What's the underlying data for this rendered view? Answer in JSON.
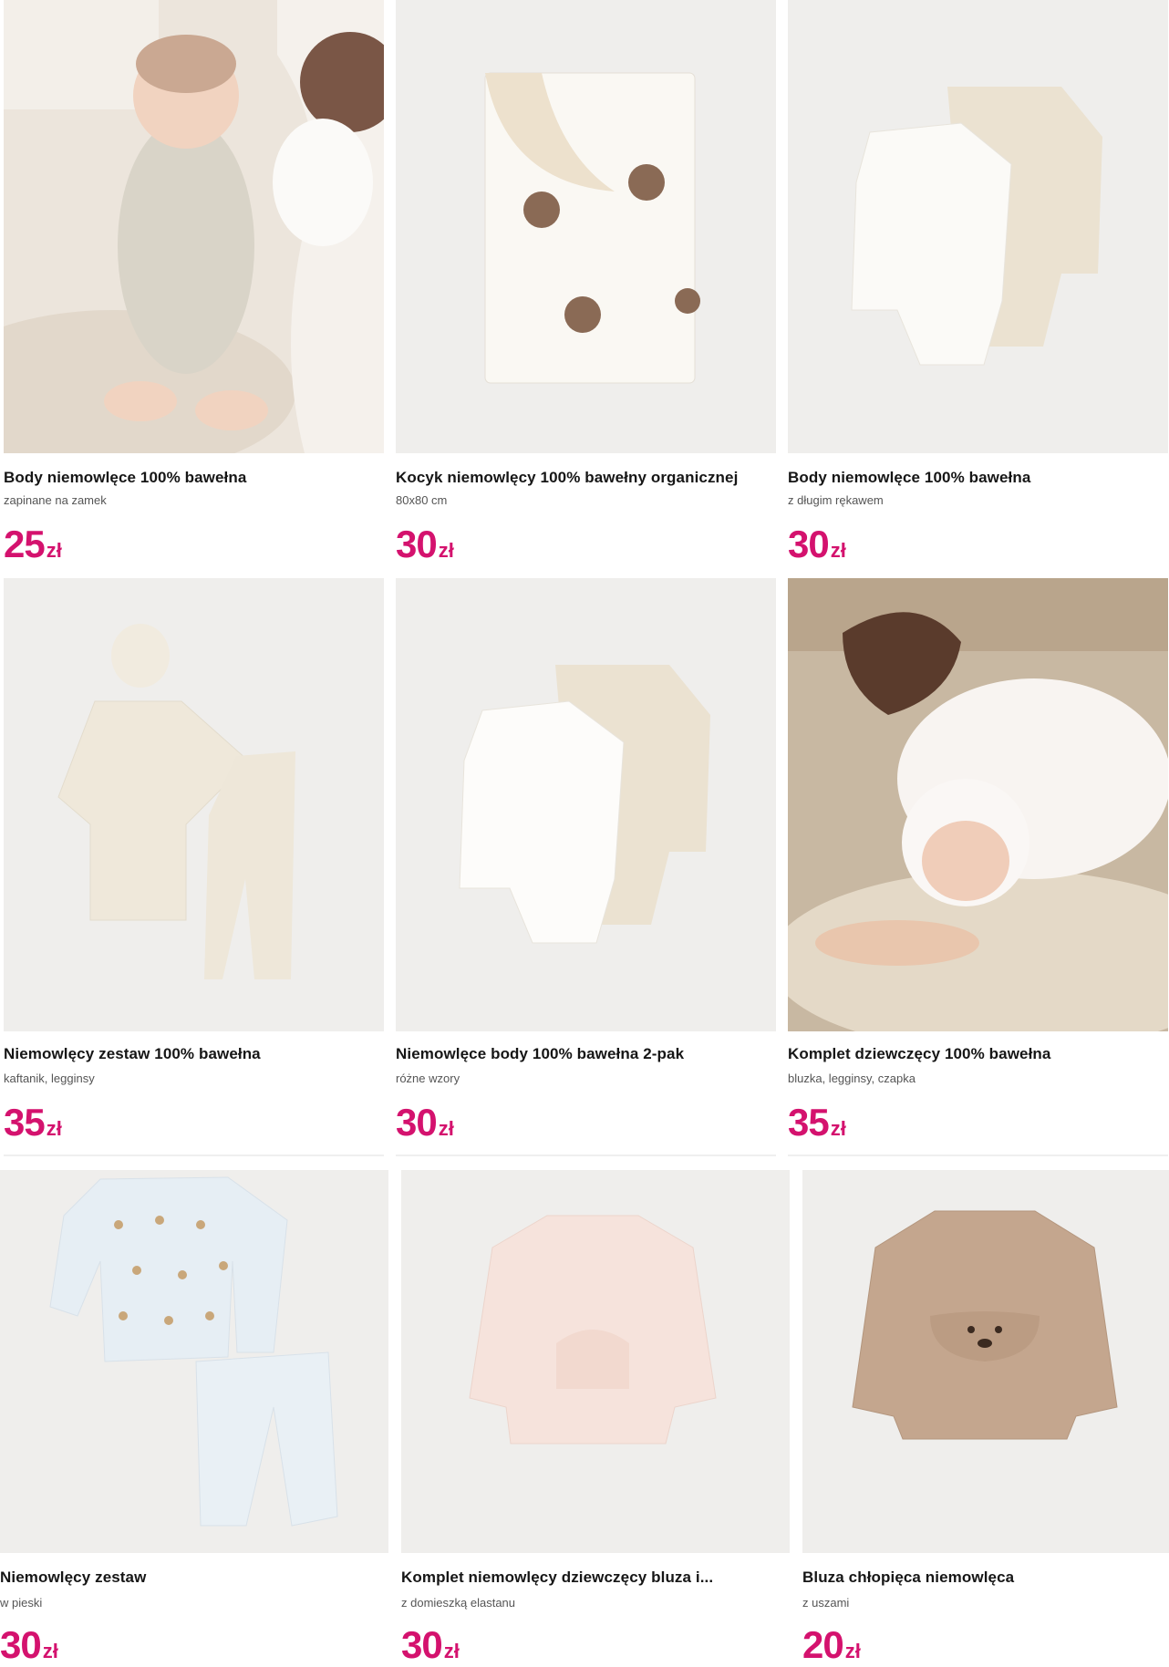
{
  "colors": {
    "price": "#d4126e",
    "image_bg": "#efeeec"
  },
  "products": [
    {
      "title": "Body niemowlęce 100% bawełna",
      "subtitle": "zapinane na zamek",
      "price": "25",
      "currency": "zł",
      "image": "baby-zip-sleepsuit-photo"
    },
    {
      "title": "Kocyk niemowlęcy 100% bawełny organicznej",
      "subtitle": "80x80 cm",
      "price": "30",
      "currency": "zł",
      "image": "puppy-blanket-photo"
    },
    {
      "title": "Body niemowlęce 100% bawełna",
      "subtitle": "z długim rękawem",
      "price": "30",
      "currency": "zł",
      "image": "bodysuit-2pack-photo"
    },
    {
      "title": "Niemowlęcy zestaw 100% bawełna",
      "subtitle": "kaftanik, legginsy",
      "price": "35",
      "currency": "zł",
      "image": "wrap-top-leggings-hat-photo"
    },
    {
      "title": "Niemowlęce body 100% bawełna 2-pak",
      "subtitle": "różne wzory",
      "price": "30",
      "currency": "zł",
      "image": "bodysuit-2pack-dots-photo"
    },
    {
      "title": "Komplet dziewczęcy 100% bawełna",
      "subtitle": "bluzka, legginsy, czapka",
      "price": "35",
      "currency": "zł",
      "image": "newborn-with-mother-photo"
    },
    {
      "title": "Niemowlęcy zestaw",
      "subtitle": "w pieski",
      "price": "30",
      "currency": "zł",
      "image": "blue-sweatshirt-pants-photo"
    },
    {
      "title": "Komplet niemowlęcy dziewczęcy bluza i...",
      "subtitle": "z domieszką elastanu",
      "price": "30",
      "currency": "zł",
      "image": "pink-sweatshirt-photo"
    },
    {
      "title": "Bluza chłopięca niemowlęca",
      "subtitle": "z uszami",
      "price": "20",
      "currency": "zł",
      "image": "brown-dog-sweatshirt-photo"
    }
  ]
}
